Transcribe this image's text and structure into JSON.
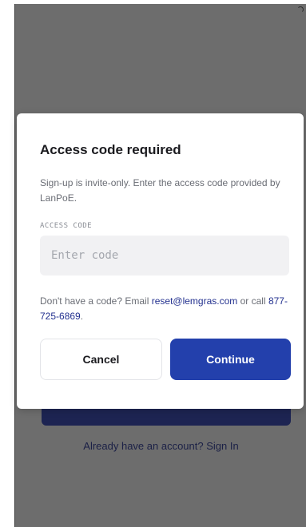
{
  "background": {
    "signin_prompt": "Already have an account? Sign In"
  },
  "modal": {
    "title": "Access code required",
    "description": "Sign-up is invite-only. Enter the access code provided by LanPoE.",
    "field_label": "ACCESS CODE",
    "code_placeholder": "Enter code",
    "code_value": "",
    "help_prefix": "Don't have a code? Email ",
    "help_email": "reset@lemgras.com",
    "help_middle": " or call ",
    "help_phone": "877-725-6869",
    "help_suffix": ".",
    "cancel_label": "Cancel",
    "continue_label": "Continue"
  },
  "colors": {
    "overlay": "#6d6d6d",
    "primary": "#2340ac",
    "link": "#23318f",
    "input_bg": "#f1f1f3"
  }
}
